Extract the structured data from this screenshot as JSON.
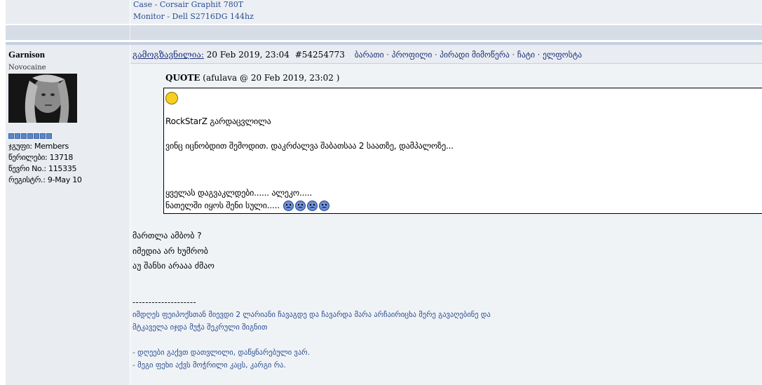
{
  "prev_post": {
    "signature_lines": [
      "Case - Corsair Graphit 780T",
      "Monitor - Dell S2716DG 144hz"
    ]
  },
  "poster": {
    "name": "Garnison",
    "title": "Novocaine",
    "group": "ჯგუფი: Members",
    "posts": "წერილები: 13718",
    "member_no": "წევრი No.: 115335",
    "registered": "რეგისტრ.: 9-May 10"
  },
  "post": {
    "posted_label": "გამოგზავნილია:",
    "date": "20 Feb 2019, 23:04",
    "post_id": "#54254773",
    "menu_links": [
      "ბარათი",
      "პროფილი",
      "პირადი მიმოწერა",
      "ჩატი",
      "ელფოსტა"
    ],
    "menu_sep": "·",
    "quote": {
      "label": "QUOTE",
      "meta": "(afulava @ 20 Feb 2019, 23:02 )",
      "lines": [
        "RockStarZ გარდაცვლილა",
        "ვინც იცნობდით შემოდით. დაკრძალვა შაბათსაა 2 საათზე, დამპალოზე...",
        "ყველას დაგვაკლდები...... ალეკო.....",
        "ნათელში იყოს შენი სული....."
      ]
    },
    "body_lines": [
      "მართლა ამბობ ?",
      "იმედია არ ხუმრობ",
      "აუ შანსი არააა ძმაო"
    ],
    "signature": {
      "divider": "--------------------",
      "lines": [
        "იმდღეს ფეიპოქსთან მიევდი 2 ლარიანი ჩავაგდე და ჩავარდა მარა არჩაირიცხა მერე გავაღებინე და",
        "მტკაველა იჯდა მუჭა შეკრული შიგნით",
        "- დღეები გაქვთ დათვლილი, დაწყნარებული ვარ.",
        "- მეგი ფეხი აქვს მოჭრილი კაცს, კარგი რა."
      ]
    }
  },
  "colors": {
    "link": "#1c2f7a",
    "signature": "#2a4c90",
    "rank_pip": "#5b86c8"
  }
}
